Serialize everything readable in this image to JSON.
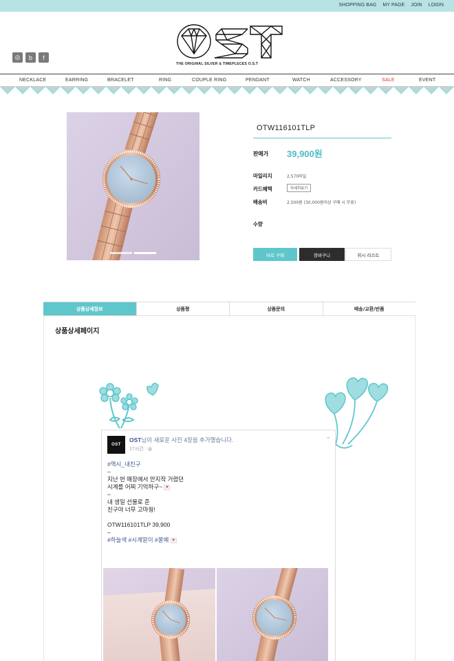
{
  "top_links": [
    "SHOPPING BAG",
    "MY PAGE",
    "JOIN",
    "LOGIN"
  ],
  "social": [
    {
      "icon": "instagram-icon",
      "glyph": "◎"
    },
    {
      "icon": "blog-icon",
      "glyph": "b"
    },
    {
      "icon": "facebook-icon",
      "glyph": "f"
    }
  ],
  "brand": {
    "logo": "OST",
    "tagline": "THE ORIGINAL SILVER & TIMEPLECES O.S.T"
  },
  "nav": [
    "NECKLACE",
    "EARRING",
    "BRACELET",
    "RING",
    "COUPLE RING",
    "PENDANT",
    "WATCH",
    "ACCESSORY",
    "SALE",
    "EVENT"
  ],
  "product": {
    "name": "OTW116101TLP",
    "price_label": "판매가",
    "price": "39,900원",
    "mileage_label": "마일리지",
    "mileage": "2,570마일",
    "card_label": "카드혜택",
    "card_button": "자세히보기",
    "shipping_label": "배송비",
    "shipping": "2,500원 (30,000원이상 구매 시 무료)",
    "qty_label": "수량",
    "buy_now": "바로 구매",
    "add_cart": "장바구니",
    "wishlist": "위시 리스트",
    "slider_count": 2,
    "slider_active": 1
  },
  "tabs": [
    "상품상세정보",
    "상품평",
    "상품문의",
    "배송/교환/반품"
  ],
  "detail_title": "상품상세페이지",
  "fb_post": {
    "avatar": "OST",
    "author": "OST",
    "action_text": "님이 새로운 사진 4장을 추가했습니다.",
    "time": "17시간 · ◍",
    "tag1": "#역시_내친구",
    "dash": "–",
    "line1": "지난 번 매장에서 만지작 거렸던",
    "line2": "시계를 어찌 기억하구~",
    "line3": "내 생일 선물로 준",
    "line4": "친구야 너무 고마웡!",
    "line5": "OTW116101TLP 39,900",
    "tags2": "#하늘색 #시계알이 #꿀예",
    "heart": "♥"
  }
}
